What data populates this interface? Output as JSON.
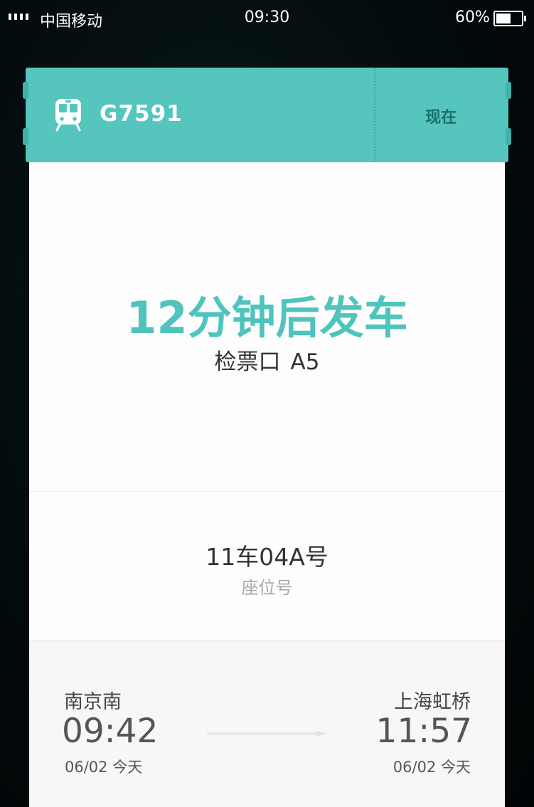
{
  "status_bar": {
    "carrier": "中国移动",
    "time": "09:30",
    "battery_percent_text": "60%",
    "battery_level": 0.6
  },
  "ticket": {
    "train_number": "G7591",
    "status_tag": "现在",
    "countdown": "12分钟后发车",
    "gate_label": "检票口",
    "gate_code": "A5",
    "seat": "11车04A号",
    "seat_label": "座位号",
    "departure": {
      "station": "南京南",
      "time": "09:42",
      "date": "06/02 今天"
    },
    "arrival": {
      "station": "上海虹桥",
      "time": "11:57",
      "date": "06/02 今天"
    }
  },
  "colors": {
    "accent": "#55c5be",
    "countdown": "#4fc4bd",
    "status_tag": "#1d6f6a"
  },
  "icons": {
    "header": "train-icon"
  }
}
